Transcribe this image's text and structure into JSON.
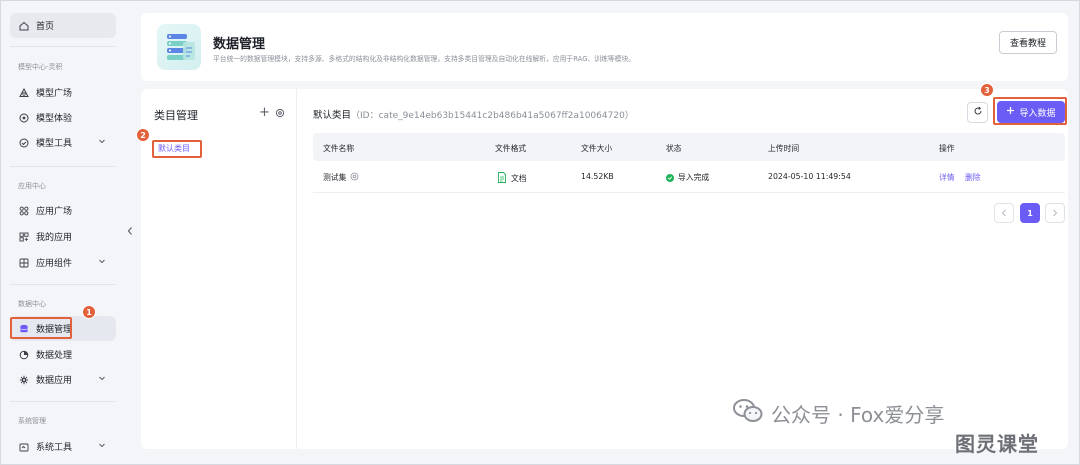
{
  "sidebar": {
    "home": "首页",
    "sections": {
      "model": "模型中心-灵积",
      "app": "应用中心",
      "data": "数据中心",
      "system": "系统管理"
    },
    "items": {
      "model_square": "模型广场",
      "model_trial": "模型体验",
      "model_tools": "模型工具",
      "app_square": "应用广场",
      "my_apps": "我的应用",
      "app_components": "应用组件",
      "data_management": "数据管理",
      "data_processing": "数据处理",
      "data_apps": "数据应用",
      "system_tools": "系统工具"
    }
  },
  "header": {
    "title": "数据管理",
    "description": "平台统一的数据管理模块，支持多源、多格式的结构化及非结构化数据管理，支持多类目管理及自动化在线解析，应用于RAG、训练等模块。",
    "tutorial_button": "查看教程"
  },
  "category_panel": {
    "title": "类目管理",
    "items": [
      "默认类目"
    ]
  },
  "main": {
    "category_name": "默认类目",
    "category_id": "（ID：cate_9e14eb63b15441c2b486b41a5067ff2a10064720）",
    "import_button": "导入数据",
    "columns": [
      "文件名称",
      "文件格式",
      "文件大小",
      "状态",
      "上传时间",
      "操作"
    ],
    "rows": [
      {
        "name": "测试集",
        "format": "文档",
        "size": "14.52KB",
        "status": "导入完成",
        "uploaded": "2024-05-10 11:49:54",
        "actions": [
          "详情",
          "删除"
        ]
      }
    ],
    "pagination": {
      "current": "1"
    }
  },
  "annotations": {
    "step1": "1",
    "step2": "2",
    "step3": "3"
  },
  "watermark": {
    "line1": "公众号 · Fox爱分享",
    "line2": "图灵课堂"
  },
  "colors": {
    "accent": "#6b5cf6",
    "highlight": "#e2603a",
    "success": "#1fb35a"
  }
}
